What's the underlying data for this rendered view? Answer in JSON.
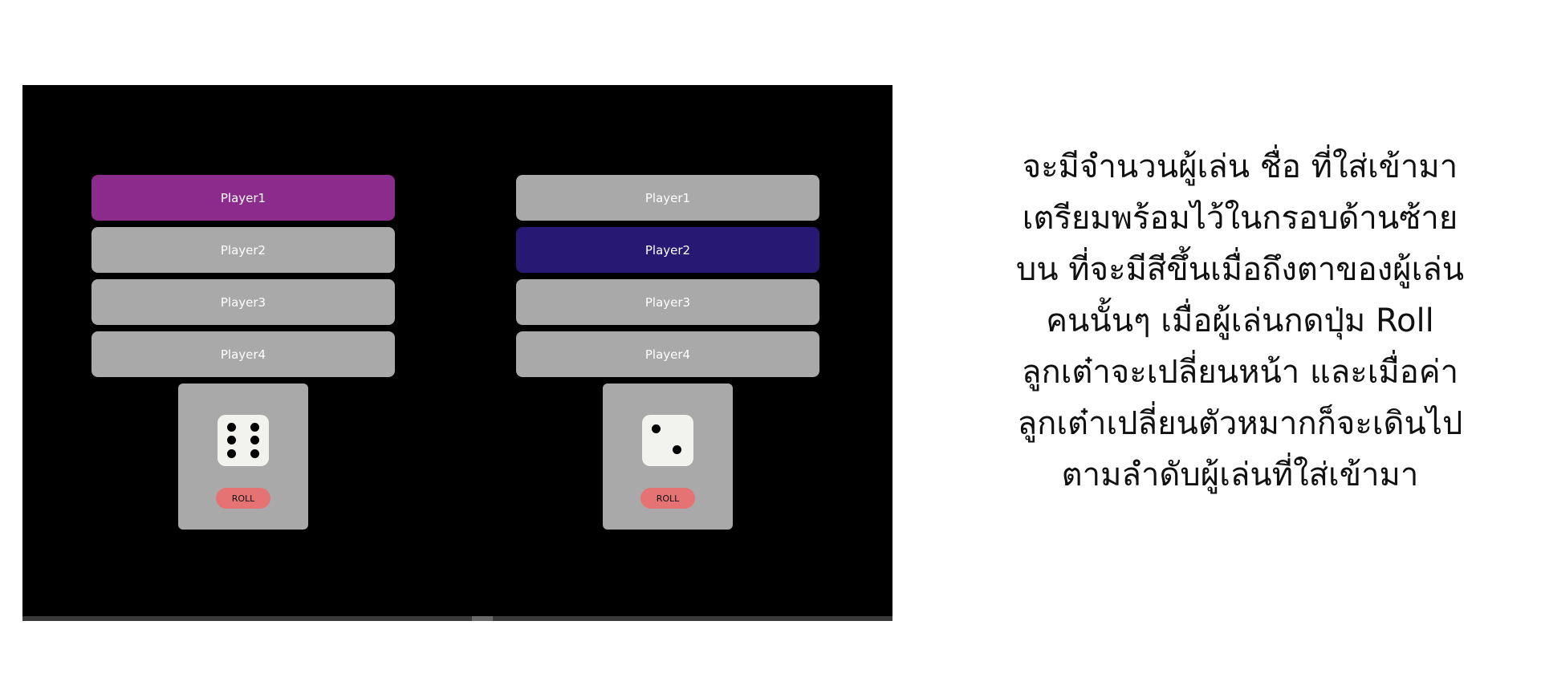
{
  "screens": [
    {
      "players": [
        "Player1",
        "Player2",
        "Player3",
        "Player4"
      ],
      "active_player": "Player1",
      "active_color": "#8b2b8c",
      "die_face": 6,
      "roll_label": "ROLL"
    },
    {
      "players": [
        "Player1",
        "Player2",
        "Player3",
        "Player4"
      ],
      "active_player": "Player2",
      "active_color": "#261873",
      "die_face": 2,
      "roll_label": "ROLL"
    }
  ],
  "description": {
    "lines": [
      "จะมีจำนวนผู้เล่น ชื่อ ที่ใส่เข้ามา",
      "เตรียมพร้อมไว้ในกรอบด้านซ้าย",
      "บน ที่จะมีสีขึ้นเมื่อถึงตาของผู้เล่น",
      "คนนั้นๆ  เมื่อผู้เล่นกดปุ่ม Roll",
      "ลูกเต๋าจะเปลี่ยนหน้า และเมื่อค่า",
      "ลูกเต๋าเปลี่ยนตัวหมากก็จะเดินไป",
      "ตามลำดับผู้เล่นที่ใส่เข้ามา"
    ]
  },
  "colors": {
    "stage_background": "#000000",
    "inactive_player": "#a9a9a9",
    "roll_button": "#e57373"
  }
}
